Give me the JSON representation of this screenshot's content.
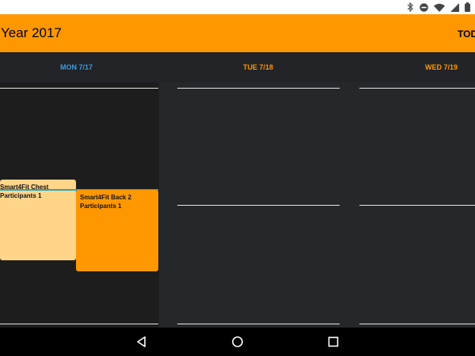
{
  "status_bar": {
    "icons": [
      "bluetooth-icon",
      "do-not-disturb-icon",
      "wifi-icon",
      "signal-icon",
      "battery-icon"
    ]
  },
  "app_bar": {
    "title": "Year 2017",
    "today_label": "TODAY",
    "background_color": "#ff9800"
  },
  "day_headers": [
    {
      "label": "MON 7/17",
      "color": "#3d9be0"
    },
    {
      "label": "TUE 7/18",
      "color": "#ff9800"
    },
    {
      "label": "WED 7/19",
      "color": "#ff9800"
    }
  ],
  "events": [
    {
      "title": "Smart4Fit Chest",
      "participants": "Participants 1",
      "color": "#ffd58a"
    },
    {
      "title": "Smart4Fit Back 2",
      "participants": "Participants 1",
      "color": "#ff9800"
    }
  ],
  "navigation_bar": {
    "icons": [
      "back-icon",
      "home-icon",
      "recent-apps-icon"
    ]
  }
}
